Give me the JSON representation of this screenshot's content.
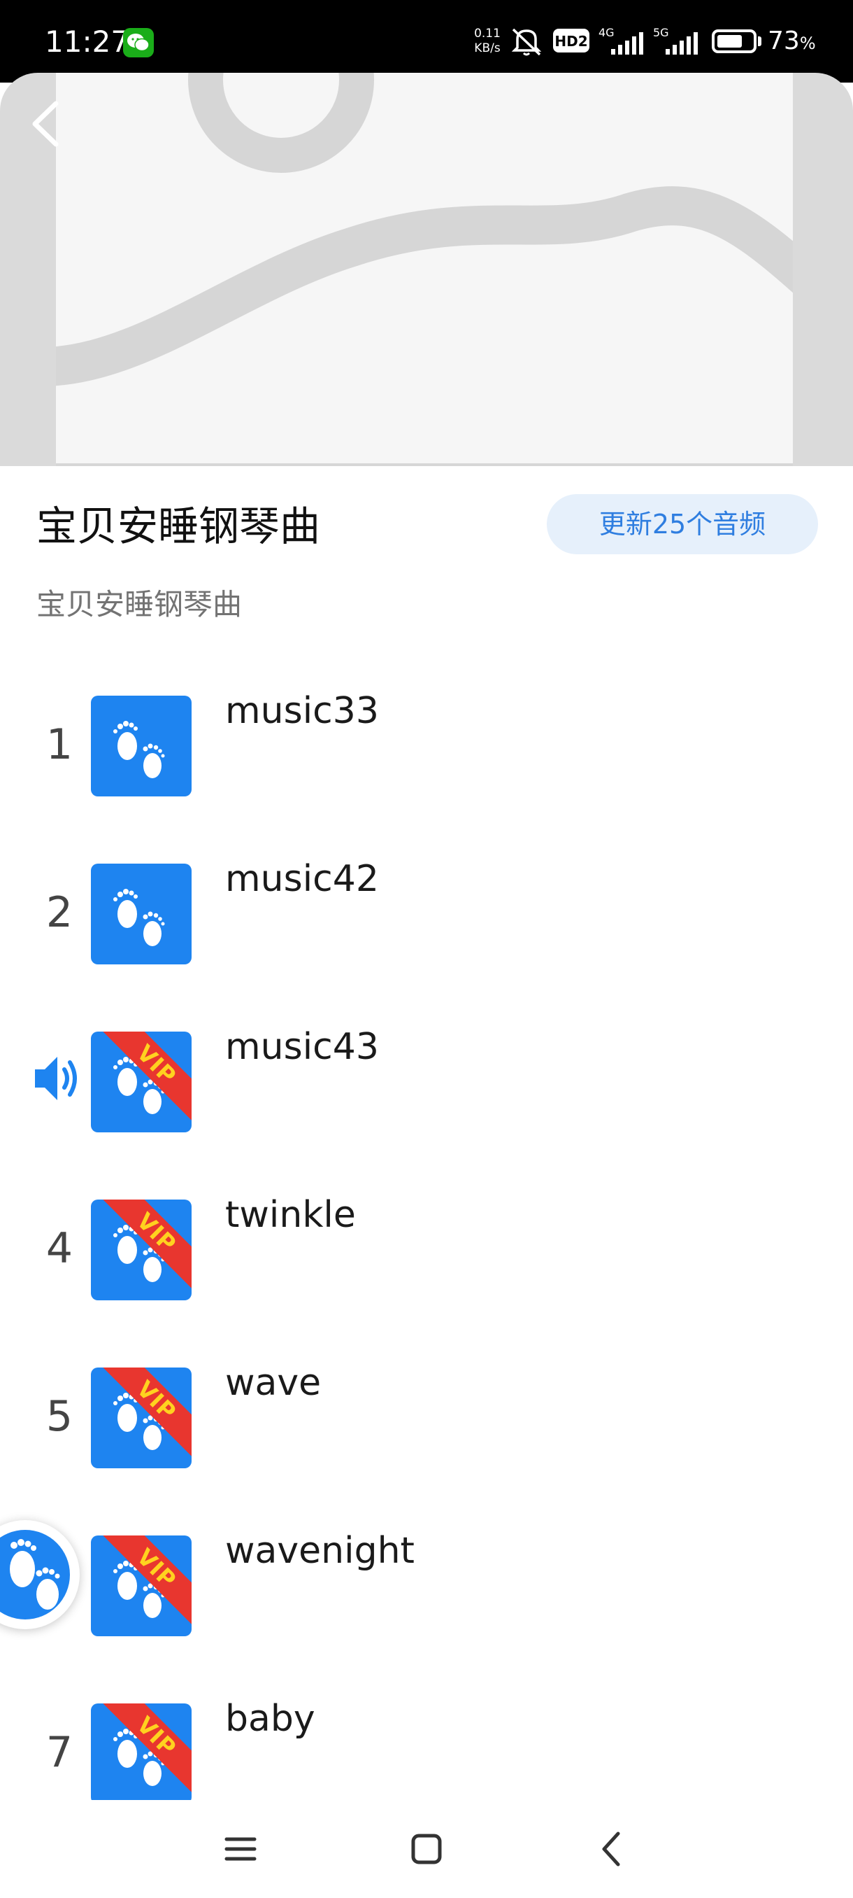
{
  "status_bar": {
    "time": "11:27",
    "net_speed_value": "0.11",
    "net_speed_unit": "KB/s",
    "hd_label": "HD2",
    "signal_1_label": "4G",
    "signal_2_label": "5G",
    "battery_level": 73,
    "battery_text": "73",
    "battery_unit": "%"
  },
  "header": {
    "back_icon": "chevron-left-icon",
    "cover_image": "image-placeholder"
  },
  "album": {
    "title": "宝贝安睡钢琴曲",
    "update_badge": "更新25个音频",
    "subtitle": "宝贝安睡钢琴曲"
  },
  "tracks": [
    {
      "index": "1",
      "title": "music33",
      "vip": false,
      "playing": false
    },
    {
      "index": "2",
      "title": "music42",
      "vip": false,
      "playing": false
    },
    {
      "index": "",
      "title": "music43",
      "vip": true,
      "playing": true
    },
    {
      "index": "4",
      "title": "twinkle",
      "vip": true,
      "playing": false
    },
    {
      "index": "5",
      "title": "wave",
      "vip": true,
      "playing": false
    },
    {
      "index": "",
      "title": "wavenight",
      "vip": true,
      "playing": false
    },
    {
      "index": "7",
      "title": "baby",
      "vip": true,
      "playing": false
    }
  ],
  "vip_label": "VIP",
  "colors": {
    "brand_blue": "#1e84f0",
    "badge_bg": "#e6f0fb",
    "badge_text": "#2f7ee0",
    "vip_red": "#e8362f",
    "vip_yellow": "#ffd21f"
  },
  "nav_bar": {
    "menu_icon": "menu-icon",
    "home_icon": "home-square-icon",
    "back_icon": "back-chevron-icon"
  }
}
